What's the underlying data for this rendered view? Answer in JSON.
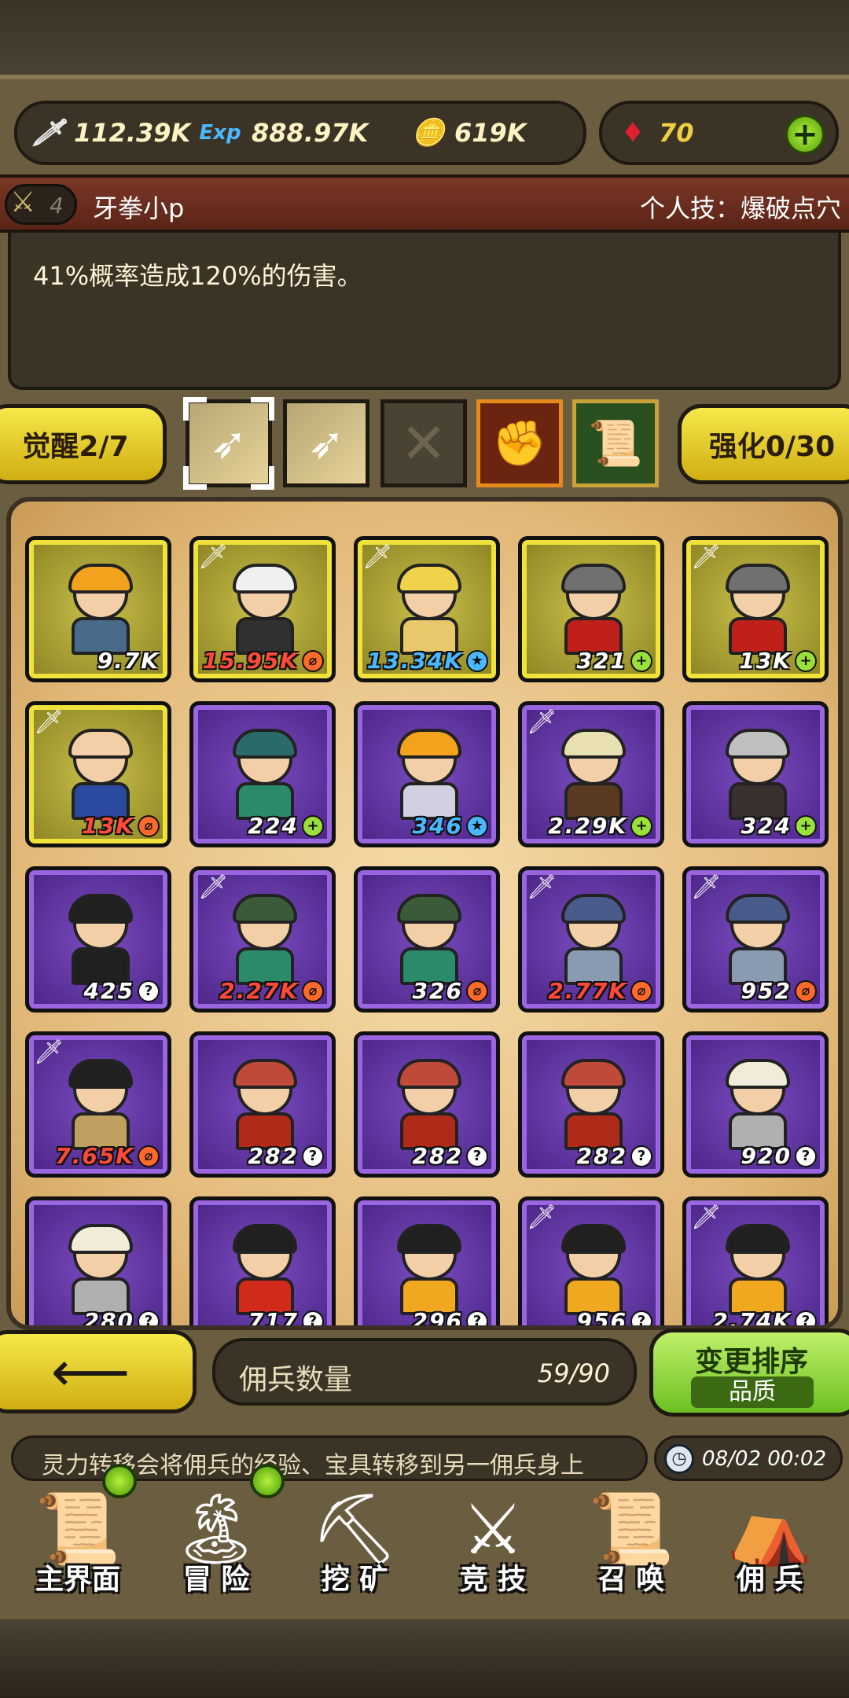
{
  "resources": {
    "attack": "112.39K",
    "exp_icon": "Exp",
    "exp": "888.97K",
    "gold": "619K",
    "gems": "70"
  },
  "skill_header": {
    "level": "4",
    "hero_name": "牙拳小p",
    "skill_name": "个人技：爆破点穴",
    "description": "41%概率造成120%的伤害。"
  },
  "awaken": {
    "label": "觉醒2/7"
  },
  "strengthen": {
    "label": "强化0/30"
  },
  "roster": [
    {
      "power": "9.7K",
      "rarity": "gold",
      "tag": "",
      "badge": "",
      "hair": "#f2a21c",
      "body": "#4a6a8a",
      "color": "#ffffff"
    },
    {
      "power": "15.95K",
      "rarity": "gold",
      "tag": "sword",
      "badge": "orange",
      "hair": "#f0f0f0",
      "body": "#303030",
      "color": "#ff4a3a"
    },
    {
      "power": "13.34K",
      "rarity": "gold",
      "tag": "sword",
      "badge": "star",
      "hair": "#f0d24a",
      "body": "#e8c86a",
      "color": "#4ab8ff"
    },
    {
      "power": "321",
      "rarity": "gold",
      "tag": "",
      "badge": "plus",
      "hair": "#707070",
      "body": "#c0201a",
      "color": "#ffffff"
    },
    {
      "power": "13K",
      "rarity": "gold",
      "tag": "sword",
      "badge": "plus",
      "hair": "#707070",
      "body": "#c0201a",
      "color": "#ffffff"
    },
    {
      "power": "13K",
      "rarity": "gold",
      "tag": "sword",
      "badge": "orange",
      "hair": "#f2cfa6",
      "body": "#2a4aa0",
      "color": "#ff4a3a"
    },
    {
      "power": "224",
      "rarity": "purple",
      "tag": "",
      "badge": "plus",
      "hair": "#2a6a6a",
      "body": "#2a8a6a",
      "color": "#ffffff"
    },
    {
      "power": "346",
      "rarity": "purple",
      "tag": "",
      "badge": "star",
      "hair": "#f2a21c",
      "body": "#d0d0e0",
      "color": "#4ab8ff"
    },
    {
      "power": "2.29K",
      "rarity": "purple",
      "tag": "sword",
      "badge": "plus",
      "hair": "#e8e0b0",
      "body": "#5a3a22",
      "color": "#ffffff"
    },
    {
      "power": "324",
      "rarity": "purple",
      "tag": "",
      "badge": "plus",
      "hair": "#c0c0c0",
      "body": "#3a3030",
      "color": "#ffffff"
    },
    {
      "power": "425",
      "rarity": "purple",
      "tag": "",
      "badge": "q",
      "hair": "#202020",
      "body": "#202020",
      "color": "#ffffff"
    },
    {
      "power": "2.27K",
      "rarity": "purple",
      "tag": "sword",
      "badge": "orange",
      "hair": "#3a5a3a",
      "body": "#2a8a6a",
      "color": "#ff4a3a"
    },
    {
      "power": "326",
      "rarity": "purple",
      "tag": "",
      "badge": "orange",
      "hair": "#3a5a3a",
      "body": "#2a8a6a",
      "color": "#ffffff"
    },
    {
      "power": "2.77K",
      "rarity": "purple",
      "tag": "sword",
      "badge": "orange",
      "hair": "#4a5a8a",
      "body": "#8a9ab0",
      "color": "#ff4a3a"
    },
    {
      "power": "952",
      "rarity": "purple",
      "tag": "sword",
      "badge": "orange",
      "hair": "#4a5a8a",
      "body": "#8a9ab0",
      "color": "#ffffff"
    },
    {
      "power": "7.65K",
      "rarity": "purple",
      "tag": "sword",
      "badge": "orange",
      "hair": "#202020",
      "body": "#c0a060",
      "color": "#ff4a3a"
    },
    {
      "power": "282",
      "rarity": "purple",
      "tag": "",
      "badge": "q",
      "hair": "#c04a3a",
      "body": "#b02a1a",
      "color": "#ffffff"
    },
    {
      "power": "282",
      "rarity": "purple",
      "tag": "",
      "badge": "q",
      "hair": "#c04a3a",
      "body": "#b02a1a",
      "color": "#ffffff"
    },
    {
      "power": "282",
      "rarity": "purple",
      "tag": "",
      "badge": "q",
      "hair": "#c04a3a",
      "body": "#b02a1a",
      "color": "#ffffff"
    },
    {
      "power": "920",
      "rarity": "purple",
      "tag": "",
      "badge": "q",
      "hair": "#f0ecd8",
      "body": "#b0b0b0",
      "color": "#ffffff"
    },
    {
      "power": "280",
      "rarity": "purple",
      "tag": "",
      "badge": "q",
      "hair": "#f0ecd8",
      "body": "#b0b0b0",
      "color": "#ffffff"
    },
    {
      "power": "717",
      "rarity": "purple",
      "tag": "",
      "badge": "q",
      "hair": "#202020",
      "body": "#d02a1a",
      "color": "#ffffff"
    },
    {
      "power": "296",
      "rarity": "purple",
      "tag": "",
      "badge": "q",
      "hair": "#202020",
      "body": "#f0a820",
      "color": "#ffffff"
    },
    {
      "power": "956",
      "rarity": "purple",
      "tag": "sword",
      "badge": "q",
      "hair": "#202020",
      "body": "#f0a820",
      "color": "#ffffff"
    },
    {
      "power": "2.74K",
      "rarity": "purple",
      "tag": "sword",
      "badge": "q",
      "hair": "#202020",
      "body": "#f0a820",
      "color": "#ffffff"
    }
  ],
  "mercenary_count": {
    "label": "佣兵数量",
    "value": "59/90"
  },
  "sort": {
    "label": "变更排序",
    "sub": "品质"
  },
  "back_arrow": "⟵",
  "tip": "灵力转移会将佣兵的经验、宝具转移到另一佣兵身上",
  "clock": "08/02 00:02",
  "nav": [
    {
      "label": "主界面",
      "icon": "map-scroll-icon",
      "glyph": "📜"
    },
    {
      "label": "冒 险",
      "icon": "island-icon",
      "glyph": "🏝"
    },
    {
      "label": "挖 矿",
      "icon": "pickaxe-icon",
      "glyph": "⛏"
    },
    {
      "label": "竞 技",
      "icon": "crossed-swords-icon",
      "glyph": "⚔"
    },
    {
      "label": "召 唤",
      "icon": "scroll-icon",
      "glyph": "📜"
    },
    {
      "label": "佣 兵",
      "icon": "tent-icon",
      "glyph": "⛺"
    }
  ]
}
